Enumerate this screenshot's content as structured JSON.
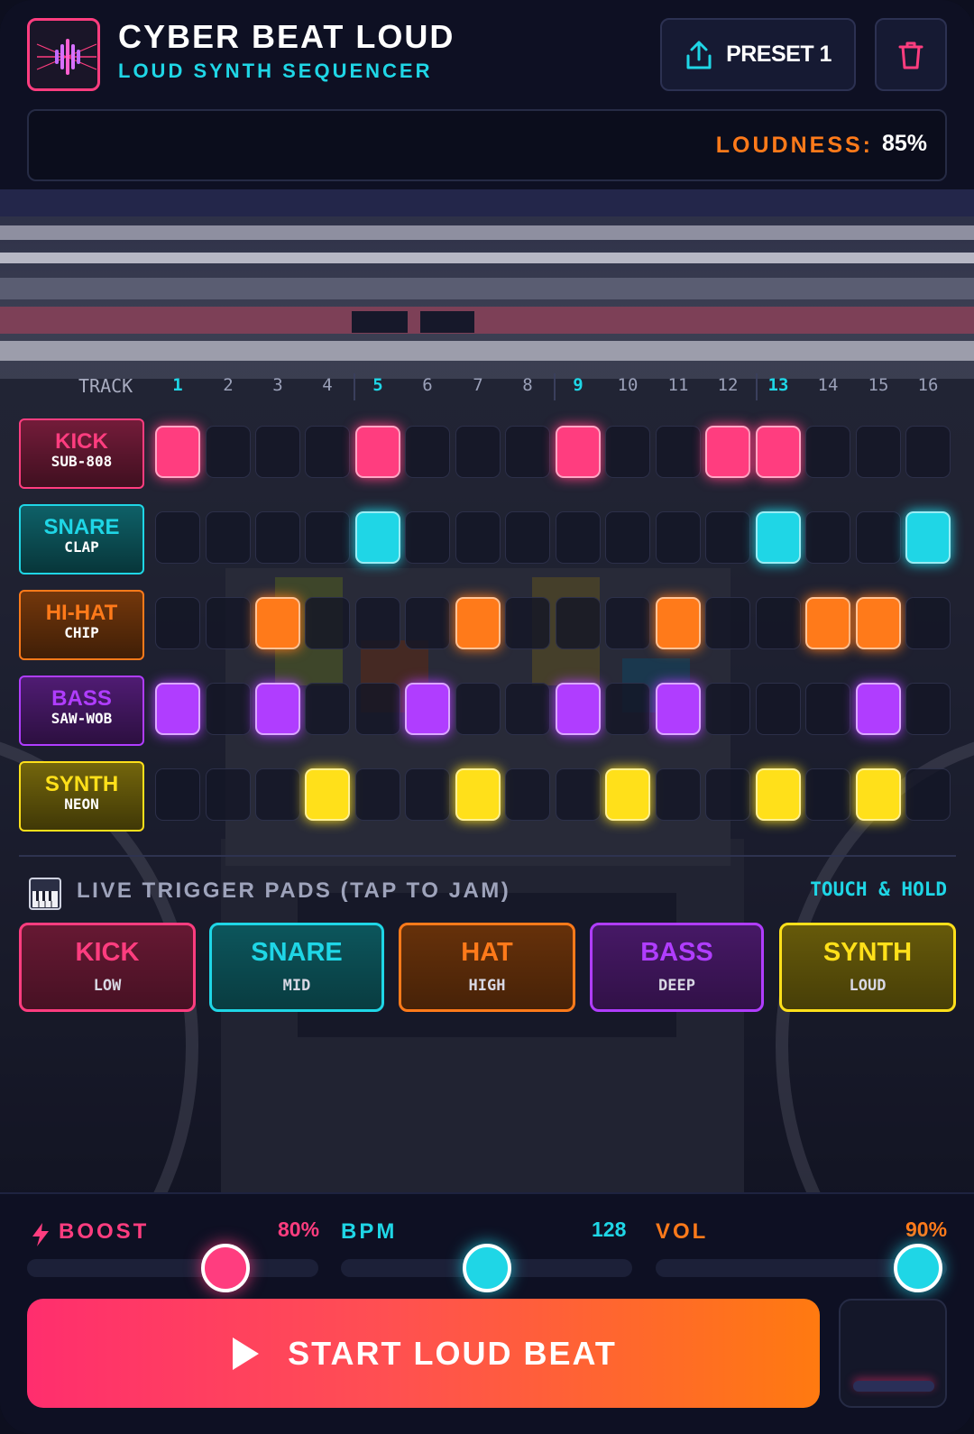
{
  "header": {
    "title": "CYBER BEAT LOUD",
    "subtitle": "LOUD SYNTH SEQUENCER",
    "preset_label": "PRESET 1",
    "loudness_label": "LOUDNESS:",
    "loudness_value": "85%"
  },
  "sequencer": {
    "track_label": "TRACK",
    "steps": [
      "1",
      "2",
      "3",
      "4",
      "5",
      "6",
      "7",
      "8",
      "9",
      "10",
      "11",
      "12",
      "13",
      "14",
      "15",
      "16"
    ],
    "rows": [
      {
        "name": "KICK",
        "sub": "SUB-808",
        "color": "#ff3d7f",
        "pattern": [
          1,
          0,
          0,
          0,
          1,
          0,
          0,
          0,
          1,
          0,
          0,
          1,
          1,
          0,
          0,
          0
        ]
      },
      {
        "name": "SNARE",
        "sub": "CLAP",
        "color": "#1fd6e6",
        "pattern": [
          0,
          0,
          0,
          0,
          1,
          0,
          0,
          0,
          0,
          0,
          0,
          0,
          1,
          0,
          0,
          1
        ]
      },
      {
        "name": "HI-HAT",
        "sub": "CHIP",
        "color": "#ff7a1a",
        "pattern": [
          0,
          0,
          1,
          0,
          0,
          0,
          1,
          0,
          0,
          0,
          1,
          0,
          0,
          1,
          1,
          0
        ]
      },
      {
        "name": "BASS",
        "sub": "SAW-WOB",
        "color": "#b03dff",
        "pattern": [
          1,
          0,
          1,
          0,
          0,
          1,
          0,
          0,
          1,
          0,
          1,
          0,
          0,
          0,
          1,
          0
        ]
      },
      {
        "name": "SYNTH",
        "sub": "NEON",
        "color": "#ffe01a",
        "pattern": [
          0,
          0,
          0,
          1,
          0,
          0,
          1,
          0,
          0,
          1,
          0,
          0,
          1,
          0,
          1,
          0
        ]
      }
    ]
  },
  "live": {
    "title": "LIVE TRIGGER PADS (TAP TO JAM)",
    "hint": "TOUCH & HOLD",
    "pads": [
      {
        "name": "KICK",
        "sub": "LOW",
        "color": "#ff3d7f"
      },
      {
        "name": "SNARE",
        "sub": "MID",
        "color": "#1fd6e6"
      },
      {
        "name": "HAT",
        "sub": "HIGH",
        "color": "#ff7a1a"
      },
      {
        "name": "BASS",
        "sub": "DEEP",
        "color": "#b03dff"
      },
      {
        "name": "SYNTH",
        "sub": "LOUD",
        "color": "#ffe01a"
      }
    ]
  },
  "controls": {
    "boost": {
      "label": "BOOST",
      "value": "80%",
      "level": 0.8,
      "color": "#ff3d7f"
    },
    "bpm": {
      "label": "BPM",
      "value": "128",
      "level": 0.5,
      "color": "#1fd6e6"
    },
    "vol": {
      "label": "VOL",
      "value": "90%",
      "level": 0.9,
      "color": "#ff7a1a"
    },
    "start_label": "START LOUD BEAT"
  },
  "icons": {
    "logo": "waveform-logo-icon",
    "preset": "share-upload-icon",
    "delete": "trash-icon",
    "live": "piano-keys-icon",
    "boost": "lightning-icon",
    "start": "play-icon"
  }
}
